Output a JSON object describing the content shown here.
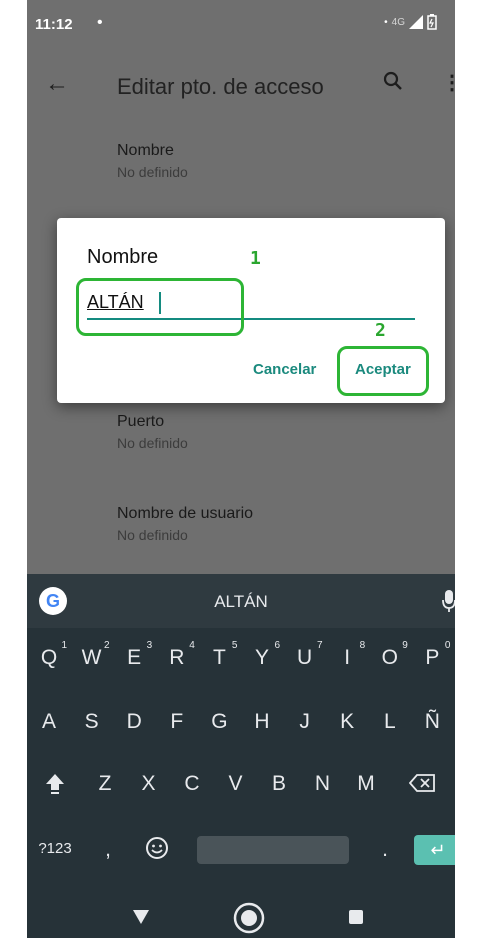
{
  "status_bar": {
    "time": "11:12",
    "dot": "•",
    "network": "4G"
  },
  "app_bar": {
    "title": "Editar pto. de acceso"
  },
  "preferences": [
    {
      "title": "Nombre",
      "subtitle": "No definido"
    },
    {
      "title": "Puerto",
      "subtitle": "No definido"
    },
    {
      "title": "Nombre de usuario",
      "subtitle": "No definido"
    }
  ],
  "dialog": {
    "title": "Nombre",
    "input_value": "ALTÁN",
    "cancel_label": "Cancelar",
    "accept_label": "Aceptar"
  },
  "annotations": {
    "step1": "1",
    "step2": "2",
    "color": "#2db535"
  },
  "keyboard": {
    "suggestion": "ALTÁN",
    "row1": [
      "Q",
      "W",
      "E",
      "R",
      "T",
      "Y",
      "U",
      "I",
      "O",
      "P"
    ],
    "row1_hints": [
      "1",
      "2",
      "3",
      "4",
      "5",
      "6",
      "7",
      "8",
      "9",
      "0"
    ],
    "row2": [
      "A",
      "S",
      "D",
      "F",
      "G",
      "H",
      "J",
      "K",
      "L",
      "Ñ"
    ],
    "row3": [
      "Z",
      "X",
      "C",
      "V",
      "B",
      "N",
      "M"
    ],
    "symbols_label": "?123",
    "comma": ",",
    "period": "."
  },
  "colors": {
    "accent": "#148b80",
    "scrim": "#6f6f6f",
    "keyboard_bg": "#263238"
  }
}
